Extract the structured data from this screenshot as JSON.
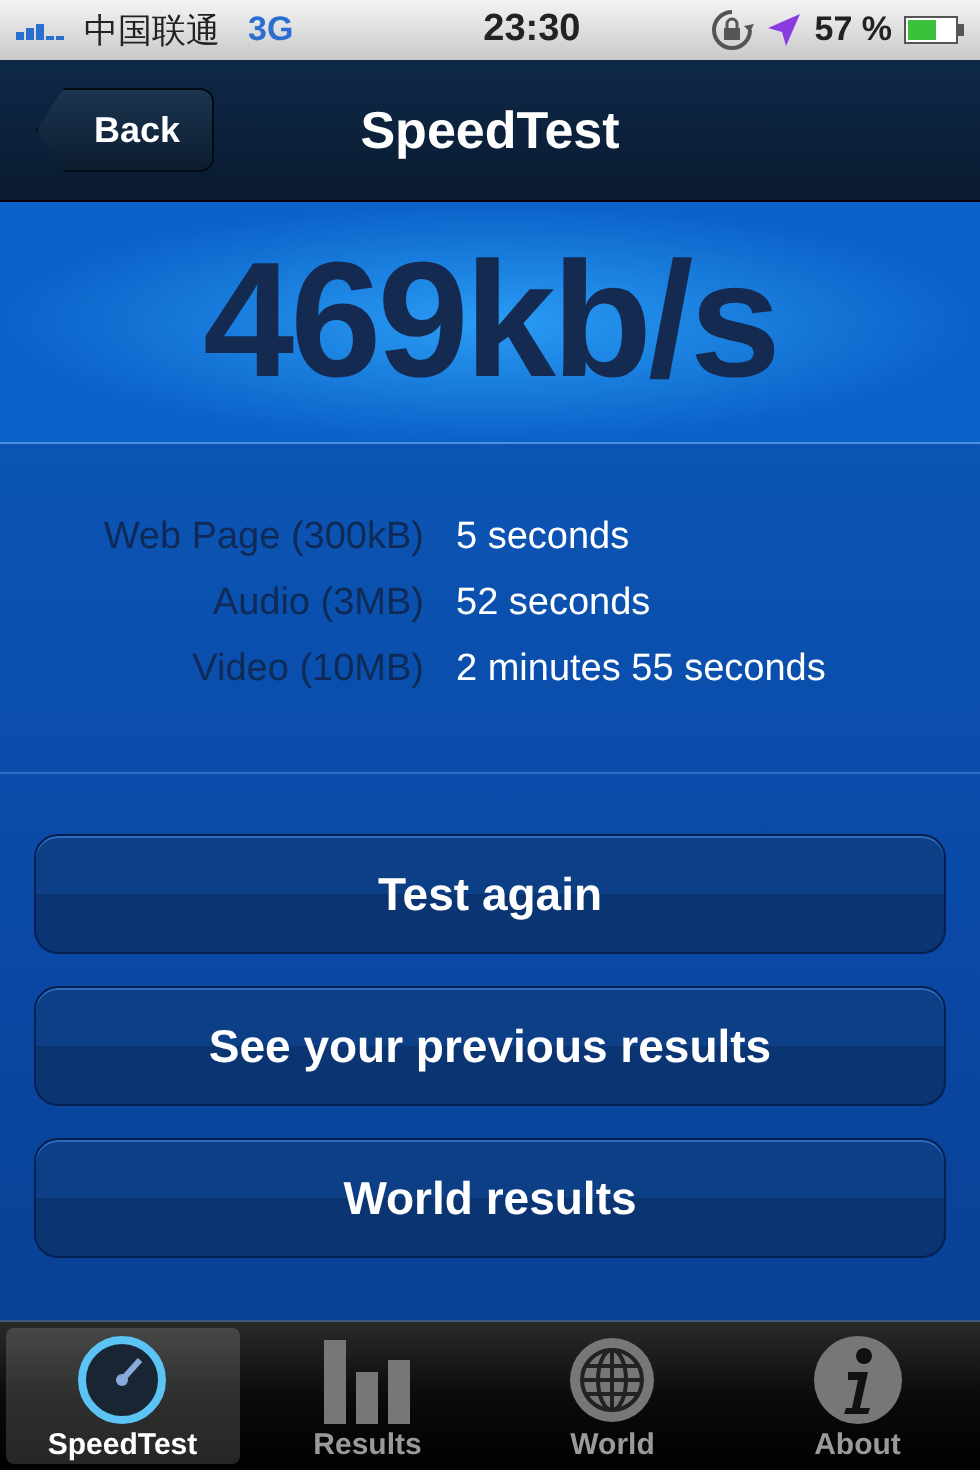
{
  "status_bar": {
    "carrier": "中国联通",
    "network": "3G",
    "time": "23:30",
    "battery": "57 %"
  },
  "nav": {
    "back": "Back",
    "title": "SpeedTest"
  },
  "speed": "469kb/s",
  "estimates": [
    {
      "label": "Web Page (300kB)",
      "value": "5 seconds"
    },
    {
      "label": "Audio (3MB)",
      "value": "52 seconds"
    },
    {
      "label": "Video (10MB)",
      "value": "2 minutes 55 seconds"
    }
  ],
  "buttons": [
    "Test again",
    "See your previous results",
    "World results"
  ],
  "tabs": [
    {
      "label": "SpeedTest",
      "kind": "gauge",
      "selected": true
    },
    {
      "label": "Results",
      "kind": "bars",
      "selected": false
    },
    {
      "label": "World",
      "kind": "globe",
      "selected": false
    },
    {
      "label": "About",
      "kind": "info",
      "selected": false
    }
  ]
}
